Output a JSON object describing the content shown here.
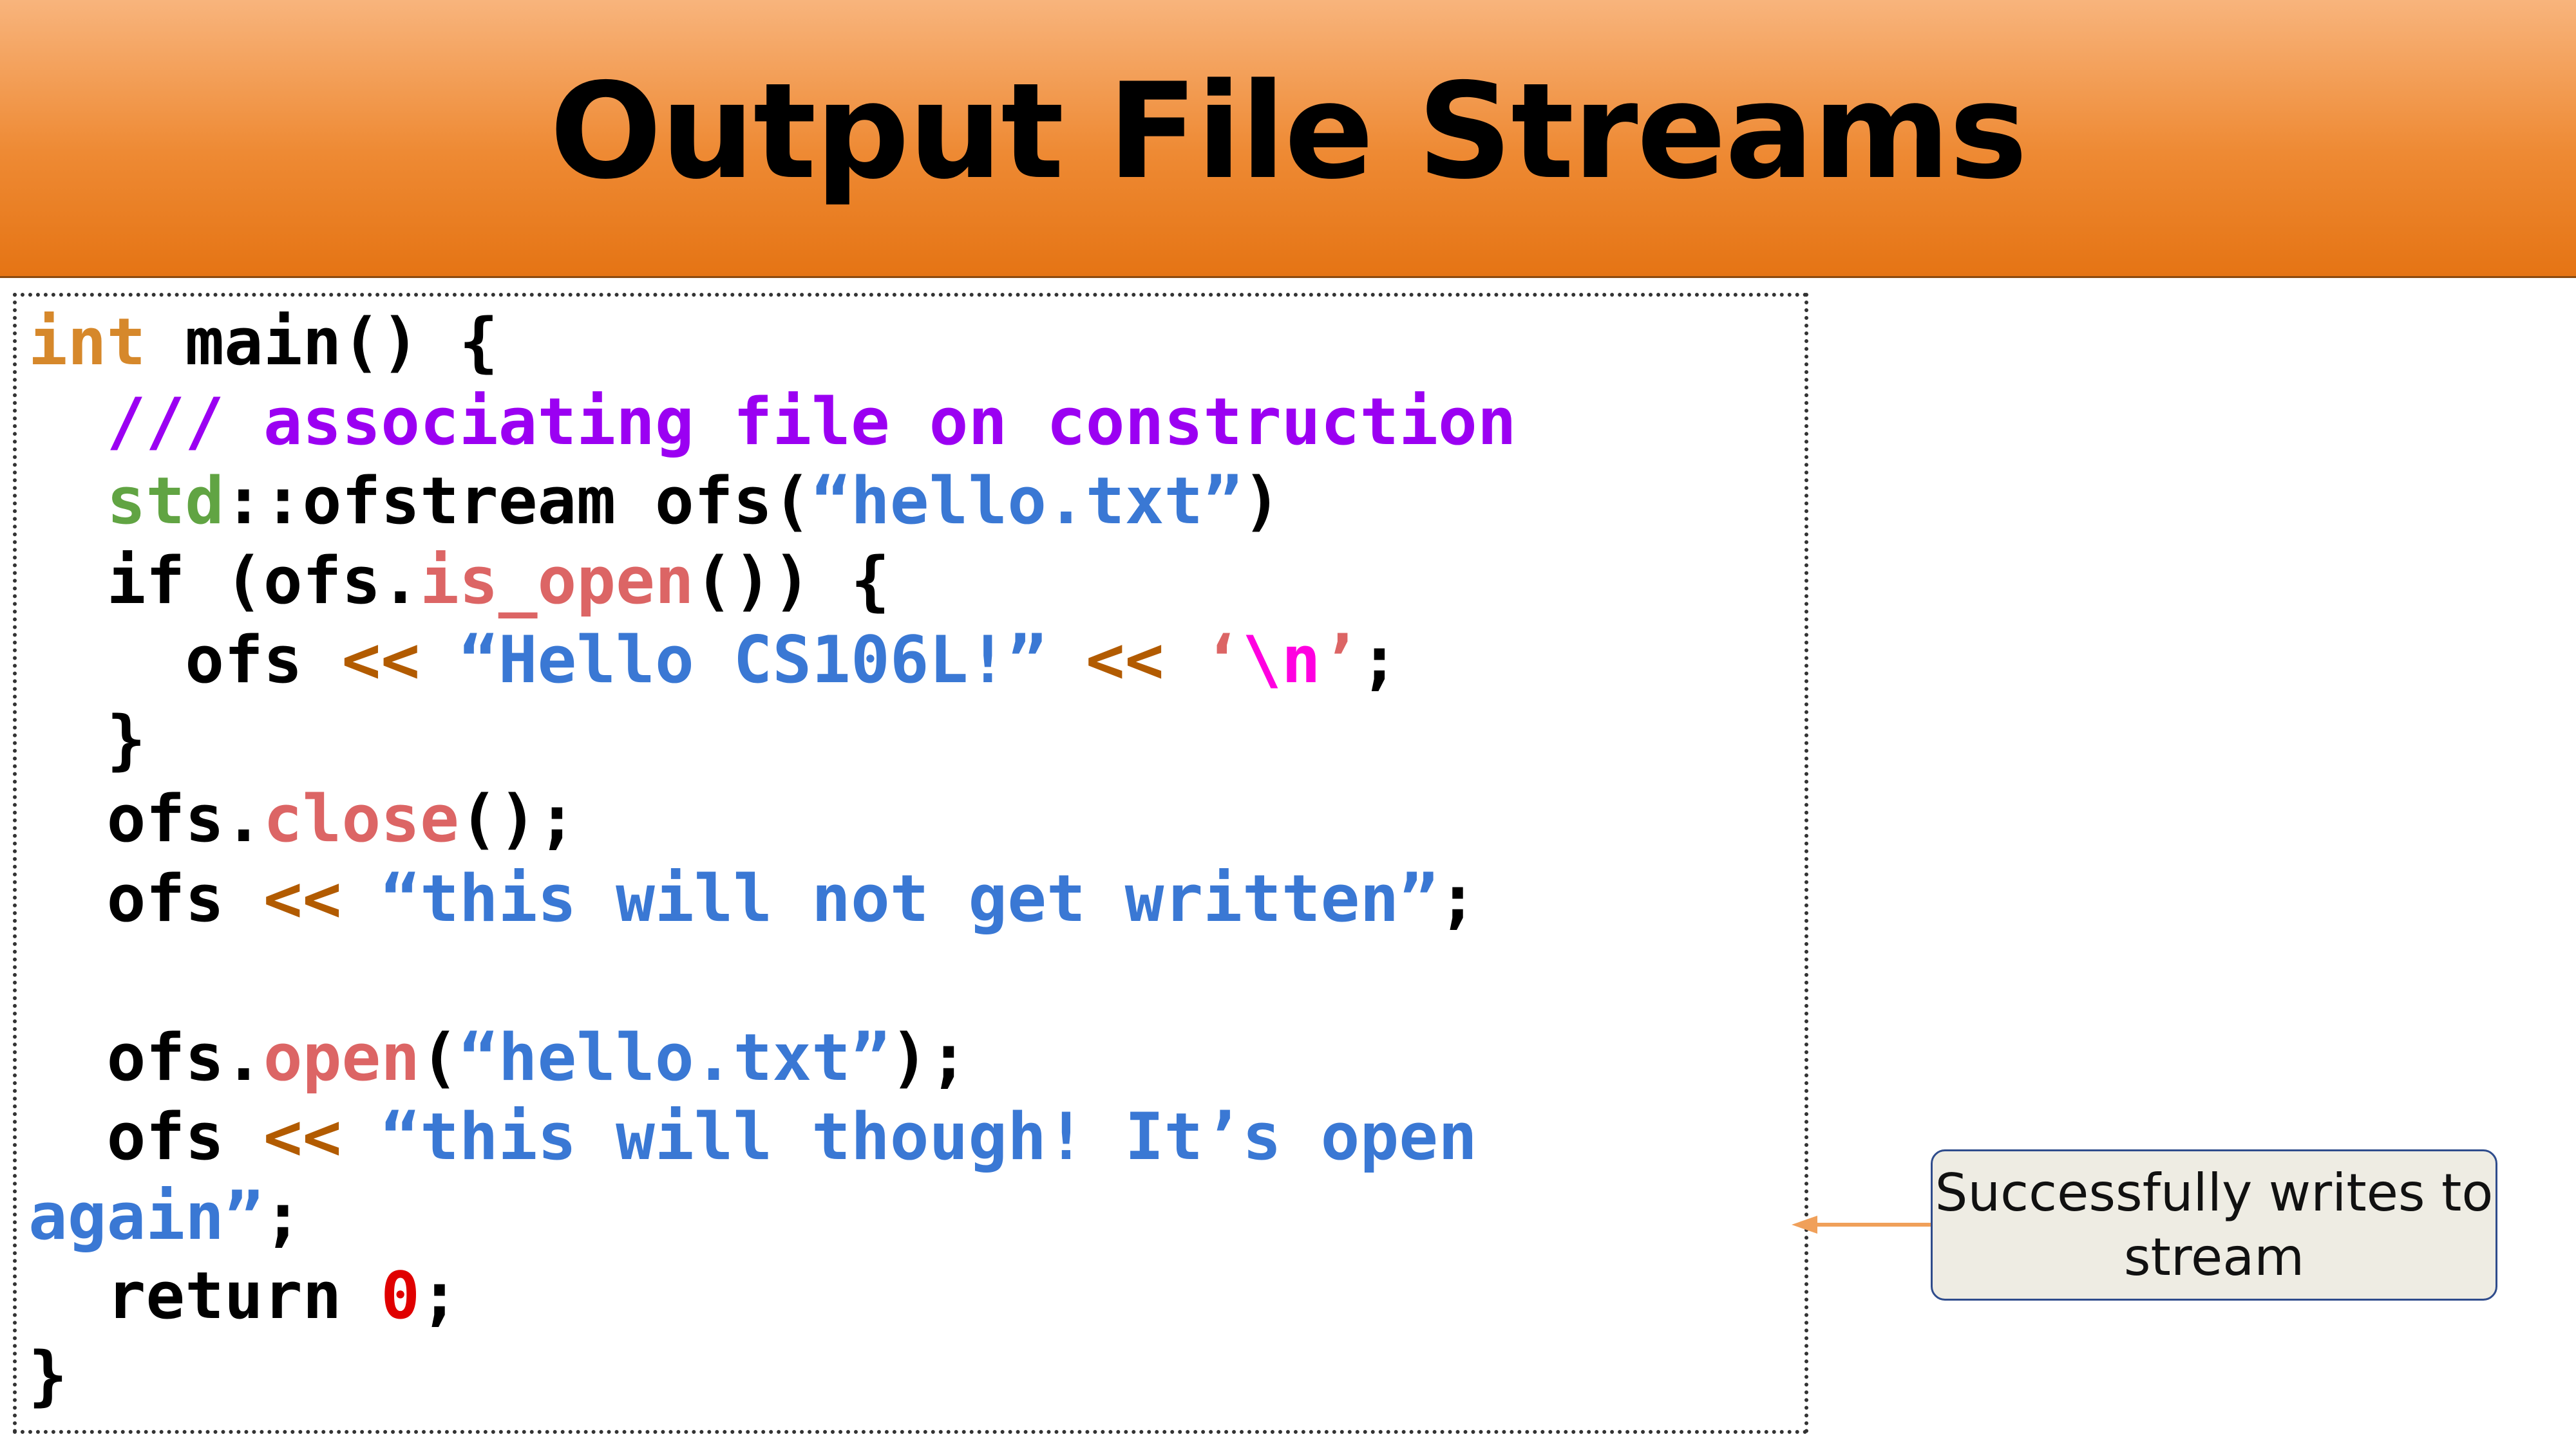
{
  "slide": {
    "title": "Output File Streams",
    "callout": "Successfully writes to stream"
  },
  "code": {
    "lines": [
      [
        {
          "t": "int",
          "c": "kw"
        },
        {
          "t": " main() {",
          "c": ""
        }
      ],
      [
        {
          "t": "  /// associating file on construction",
          "c": "cm"
        }
      ],
      [
        {
          "t": "  ",
          "c": ""
        },
        {
          "t": "std",
          "c": "ns"
        },
        {
          "t": "::ofstream ofs(",
          "c": ""
        },
        {
          "t": "“hello.txt”",
          "c": "str"
        },
        {
          "t": ")",
          "c": ""
        }
      ],
      [
        {
          "t": "  if (ofs.",
          "c": ""
        },
        {
          "t": "is_open",
          "c": "fn"
        },
        {
          "t": "()) {",
          "c": ""
        }
      ],
      [
        {
          "t": "    ofs ",
          "c": ""
        },
        {
          "t": "<<",
          "c": "op"
        },
        {
          "t": " ",
          "c": ""
        },
        {
          "t": "“Hello CS106L!”",
          "c": "str"
        },
        {
          "t": " ",
          "c": ""
        },
        {
          "t": "<<",
          "c": "op"
        },
        {
          "t": " ",
          "c": ""
        },
        {
          "t": "‘",
          "c": "fn"
        },
        {
          "t": "\\n",
          "c": "esc"
        },
        {
          "t": "’",
          "c": "fn"
        },
        {
          "t": ";",
          "c": ""
        }
      ],
      [
        {
          "t": "  }",
          "c": ""
        }
      ],
      [
        {
          "t": "  ofs.",
          "c": ""
        },
        {
          "t": "close",
          "c": "fn"
        },
        {
          "t": "();",
          "c": ""
        }
      ],
      [
        {
          "t": "  ofs ",
          "c": ""
        },
        {
          "t": "<<",
          "c": "op"
        },
        {
          "t": " ",
          "c": ""
        },
        {
          "t": "“this will not get written”",
          "c": "str"
        },
        {
          "t": ";",
          "c": ""
        }
      ],
      [],
      [
        {
          "t": "  ofs.",
          "c": ""
        },
        {
          "t": "open",
          "c": "fn"
        },
        {
          "t": "(",
          "c": ""
        },
        {
          "t": "“hello.txt”",
          "c": "str"
        },
        {
          "t": ");",
          "c": ""
        }
      ],
      [
        {
          "t": "  ofs ",
          "c": ""
        },
        {
          "t": "<<",
          "c": "op"
        },
        {
          "t": " ",
          "c": ""
        },
        {
          "t": "“this will though! It’s open",
          "c": "str"
        }
      ],
      [
        {
          "t": "again”",
          "c": "str"
        },
        {
          "t": ";",
          "c": ""
        }
      ],
      [
        {
          "t": "  return ",
          "c": ""
        },
        {
          "t": "0",
          "c": "num"
        },
        {
          "t": ";",
          "c": ""
        }
      ],
      [
        {
          "t": "}",
          "c": ""
        }
      ]
    ]
  },
  "colors": {
    "header_top": "#f8b47c",
    "header_bottom": "#e57414",
    "keyword": "#d6882b",
    "comment": "#9b00f2",
    "namespace": "#61a443",
    "string": "#3a78d4",
    "function": "#dc6565",
    "operator": "#b25b00",
    "escape": "#ff00e0",
    "number": "#e00000",
    "arrow": "#f0a05a",
    "callout_bg": "#eeece3",
    "callout_border": "#2f4c8c"
  }
}
